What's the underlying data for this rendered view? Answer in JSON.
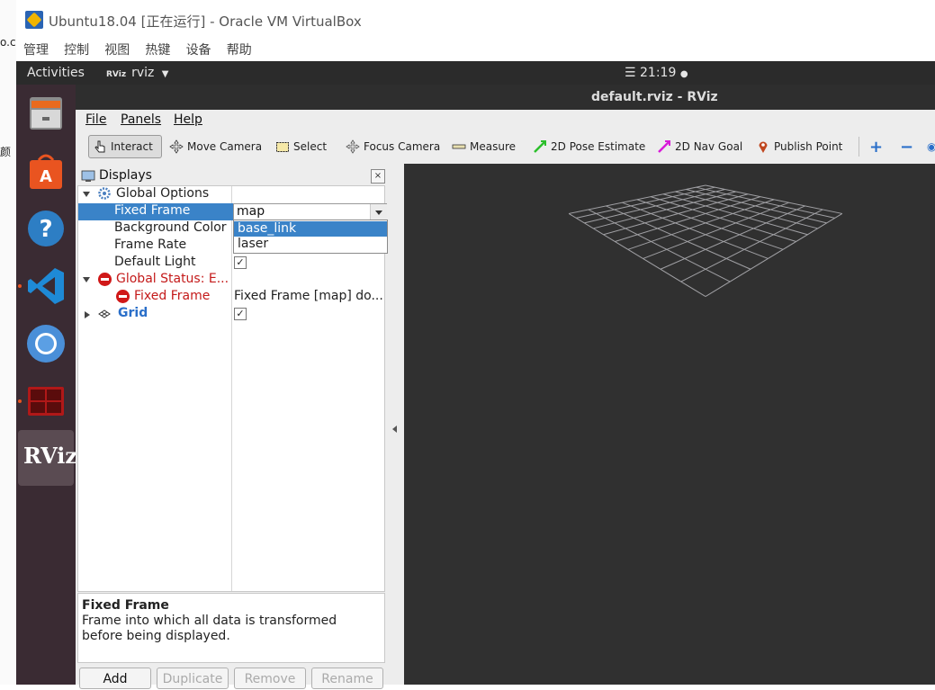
{
  "vbox": {
    "title": "Ubuntu18.04 [正在运行] - Oracle VM VirtualBox",
    "menu": [
      "管理",
      "控制",
      "视图",
      "热键",
      "设备",
      "帮助"
    ]
  },
  "host_fragments": [
    "o.cs",
    "颜"
  ],
  "gnome": {
    "activities": "Activities",
    "app_badge": "RViz",
    "app_name": "rviz",
    "clock": "21:19"
  },
  "dock": {
    "items": [
      "files-icon",
      "software-store-icon",
      "help-icon",
      "vscode-icon",
      "chromium-icon",
      "terminal-icon",
      "rviz-icon"
    ],
    "rviz_label": "RViz"
  },
  "rviz": {
    "window_title": "default.rviz - RViz",
    "menu": {
      "file": "File",
      "panels": "Panels",
      "help": "Help"
    },
    "toolbar": {
      "interact": "Interact",
      "move_camera": "Move Camera",
      "select": "Select",
      "focus_camera": "Focus Camera",
      "measure": "Measure",
      "pose_estimate": "2D Pose Estimate",
      "nav_goal": "2D Nav Goal",
      "publish_point": "Publish Point"
    },
    "displays": {
      "title": "Displays",
      "close": "×",
      "rows": {
        "global_options": "Global Options",
        "fixed_frame": "Fixed Frame",
        "background_color": "Background Color",
        "frame_rate": "Frame Rate",
        "default_light": "Default Light",
        "global_status": "Global Status: E...",
        "status_fixed_frame": "Fixed Frame",
        "status_fixed_frame_value": "Fixed Frame [map] do...",
        "grid": "Grid"
      },
      "fixed_frame_value": "map",
      "dropdown_options": [
        "base_link",
        "laser"
      ],
      "dropdown_highlight": "base_link",
      "checks": {
        "default_light": "✓",
        "grid": "✓"
      }
    },
    "description": {
      "title": "Fixed Frame",
      "body": "Frame into which all data is transformed before being displayed."
    },
    "buttons": {
      "add": "Add",
      "duplicate": "Duplicate",
      "remove": "Remove",
      "rename": "Rename"
    }
  }
}
